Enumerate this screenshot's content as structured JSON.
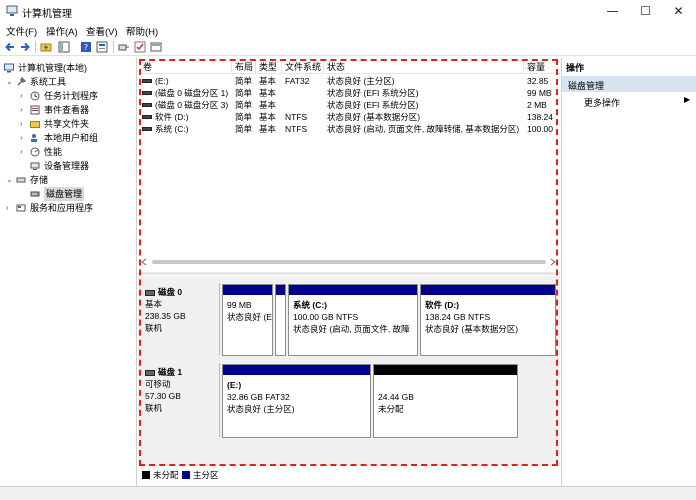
{
  "window": {
    "title": "计算机管理",
    "minimize": "—",
    "maximize": "☐",
    "close": "✕"
  },
  "menu": [
    "文件(F)",
    "操作(A)",
    "查看(V)",
    "帮助(H)"
  ],
  "tree": {
    "root": "计算机管理(本地)",
    "system_tools": "系统工具",
    "task_scheduler": "任务计划程序",
    "event_viewer": "事件查看器",
    "shared_folders": "共享文件夹",
    "local_users": "本地用户和组",
    "performance": "性能",
    "device_manager": "设备管理器",
    "storage": "存储",
    "disk_management": "磁盘管理",
    "services": "服务和应用程序"
  },
  "volume_table": {
    "headers": [
      "卷",
      "布局",
      "类型",
      "文件系统",
      "状态",
      "容量"
    ],
    "rows": [
      [
        "(E:)",
        "简单",
        "基本",
        "FAT32",
        "状态良好 (主分区)",
        "32.85"
      ],
      [
        "(磁盘 0 磁盘分区 1)",
        "简单",
        "基本",
        "",
        "状态良好 (EFI 系统分区)",
        "99 MB"
      ],
      [
        "(磁盘 0 磁盘分区 3)",
        "简单",
        "基本",
        "",
        "状态良好 (EFI 系统分区)",
        "2 MB"
      ],
      [
        "软件 (D:)",
        "简单",
        "基本",
        "NTFS",
        "状态良好 (基本数据分区)",
        "138.24"
      ],
      [
        "系统 (C:)",
        "简单",
        "基本",
        "NTFS",
        "状态良好 (启动, 页面文件, 故障转储, 基本数据分区)",
        "100.00"
      ]
    ]
  },
  "disks": [
    {
      "name": "磁盘 0",
      "type": "基本",
      "size": "238.35 GB",
      "status": "联机",
      "partitions": [
        {
          "title": "",
          "line1": "99 MB",
          "line2": "状态良好 (E",
          "bar": "#00008b"
        },
        {
          "title": "",
          "line1": "",
          "line2": "",
          "bar": "#00008b"
        },
        {
          "title": "系统 (C:)",
          "line1": "100.00 GB NTFS",
          "line2": "状态良好 (启动, 页面文件, 故障",
          "bar": "#00008b"
        },
        {
          "title": "软件 (D:)",
          "line1": "138.24 GB NTFS",
          "line2": "状态良好 (基本数据分区)",
          "bar": "#00008b"
        }
      ]
    },
    {
      "name": "磁盘 1",
      "type": "可移动",
      "size": "57.30 GB",
      "status": "联机",
      "partitions": [
        {
          "title": "(E:)",
          "line1": "32.86 GB FAT32",
          "line2": "状态良好 (主分区)",
          "bar": "#00008b"
        },
        {
          "title": "",
          "line1": "24.44 GB",
          "line2": "未分配",
          "bar": "#000000"
        }
      ]
    }
  ],
  "legend": [
    {
      "label": "未分配",
      "color": "#000000"
    },
    {
      "label": "主分区",
      "color": "#00008b"
    }
  ],
  "actions": {
    "title": "操作",
    "section": "磁盘管理",
    "more": "更多操作",
    "more_arrow": "▶"
  }
}
